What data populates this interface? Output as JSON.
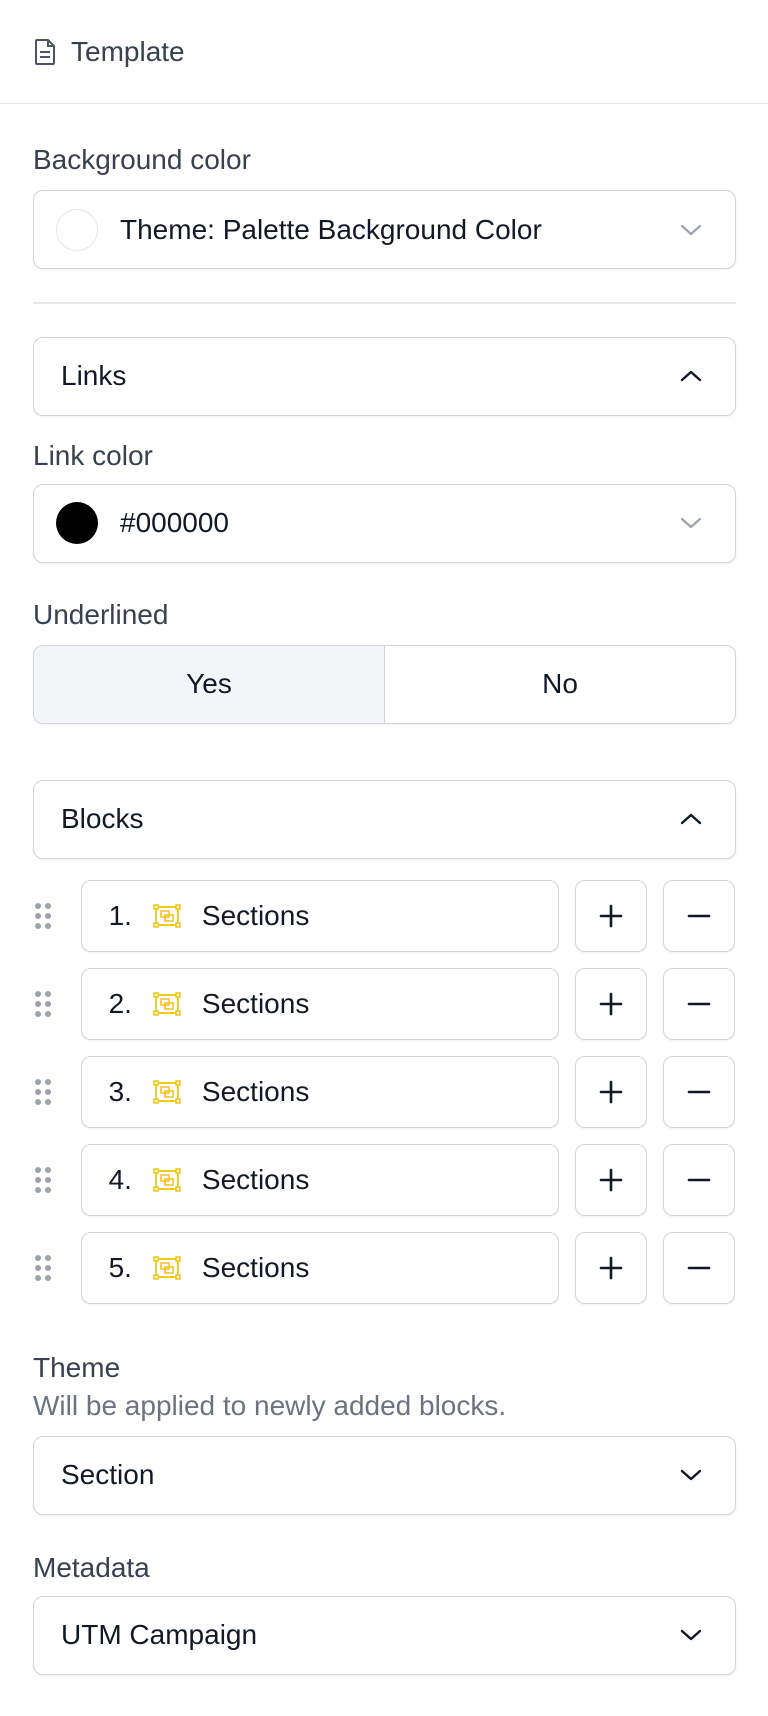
{
  "header": {
    "title": "Template",
    "icon": "document-icon"
  },
  "background": {
    "label": "Background color",
    "value": "Theme: Palette Background Color",
    "swatch_color": "#ffffff"
  },
  "links": {
    "section_title": "Links",
    "link_color_label": "Link color",
    "link_color_value": "#000000",
    "swatch_color": "#000000",
    "underlined_label": "Underlined",
    "underlined_options": [
      "Yes",
      "No"
    ],
    "underlined_selected": "Yes"
  },
  "blocks": {
    "section_title": "Blocks",
    "items": [
      {
        "number": "1.",
        "label": "Sections"
      },
      {
        "number": "2.",
        "label": "Sections"
      },
      {
        "number": "3.",
        "label": "Sections"
      },
      {
        "number": "4.",
        "label": "Sections"
      },
      {
        "number": "5.",
        "label": "Sections"
      }
    ],
    "icon_color": "#f1c40f"
  },
  "theme": {
    "label": "Theme",
    "help": "Will be applied to newly added blocks.",
    "value": "Section"
  },
  "metadata": {
    "label": "Metadata",
    "value": "UTM Campaign"
  }
}
